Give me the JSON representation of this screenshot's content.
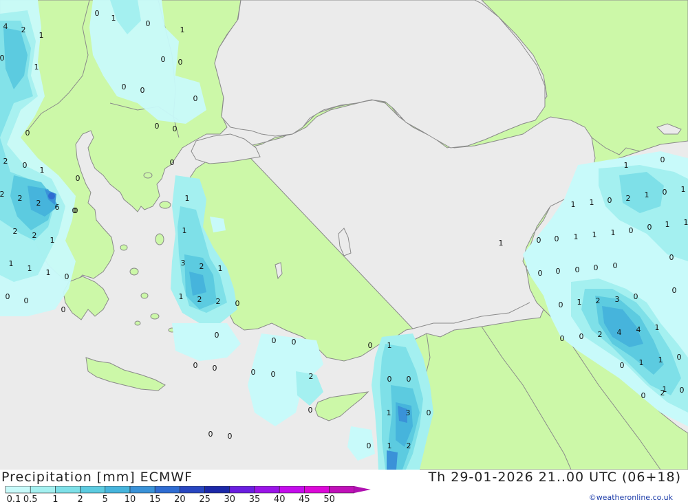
{
  "header": {
    "title": "Precipitation [mm] ECMWF",
    "datetime": "Th 29-01-2026 21..00 UTC (06+18)",
    "credit": "©weatheronline.co.uk"
  },
  "legend": {
    "labels": [
      "0.1",
      "0.5",
      "1",
      "2",
      "5",
      "10",
      "15",
      "20",
      "25",
      "30",
      "35",
      "40",
      "45",
      "50"
    ],
    "colors": [
      "#c8fafa",
      "#a4f0f0",
      "#7ee0e8",
      "#5ccbe0",
      "#46b4dc",
      "#3a92d8",
      "#2f6cd2",
      "#2846c0",
      "#1c28a8",
      "#6a1ee0",
      "#9a14e8",
      "#c40cec",
      "#dc08d8",
      "#c010b8"
    ]
  },
  "map": {
    "colors": {
      "sea": "#ebebeb",
      "land_no_precip": "#ccf8a8",
      "border": "#8a8a8a"
    },
    "values": [
      "4",
      "2",
      "1",
      "0",
      "1",
      "0",
      "0",
      "1",
      "0",
      "0",
      "1",
      "0",
      "0",
      "0",
      "0",
      "0",
      "0",
      "2",
      "0",
      "1",
      "0",
      "2",
      "2",
      "2",
      "6",
      "0",
      "2",
      "2",
      "1",
      "1",
      "1",
      "1",
      "0",
      "0",
      "0",
      "0",
      "1",
      "0",
      "1",
      "3",
      "2",
      "1",
      "1",
      "2",
      "2",
      "0",
      "0",
      "0",
      "0",
      "0",
      "0",
      "0",
      "0",
      "0",
      "0",
      "2",
      "0",
      "1",
      "0",
      "0",
      "0",
      "1",
      "3",
      "0",
      "0",
      "1",
      "2",
      "1",
      "0",
      "1",
      "0",
      "1",
      "2",
      "0",
      "1",
      "1",
      "1",
      "1",
      "0",
      "0",
      "1",
      "1",
      "1",
      "0",
      "0",
      "1",
      "0",
      "0",
      "0",
      "0",
      "0",
      "0",
      "0",
      "1",
      "2",
      "3",
      "0",
      "0",
      "0",
      "2",
      "4",
      "4",
      "1",
      "0",
      "1",
      "1",
      "0",
      "0",
      "0",
      "2",
      "0",
      "1",
      "0",
      "0",
      "0",
      "0",
      "0",
      "0",
      "1",
      "0",
      "0",
      "1",
      "0"
    ]
  }
}
